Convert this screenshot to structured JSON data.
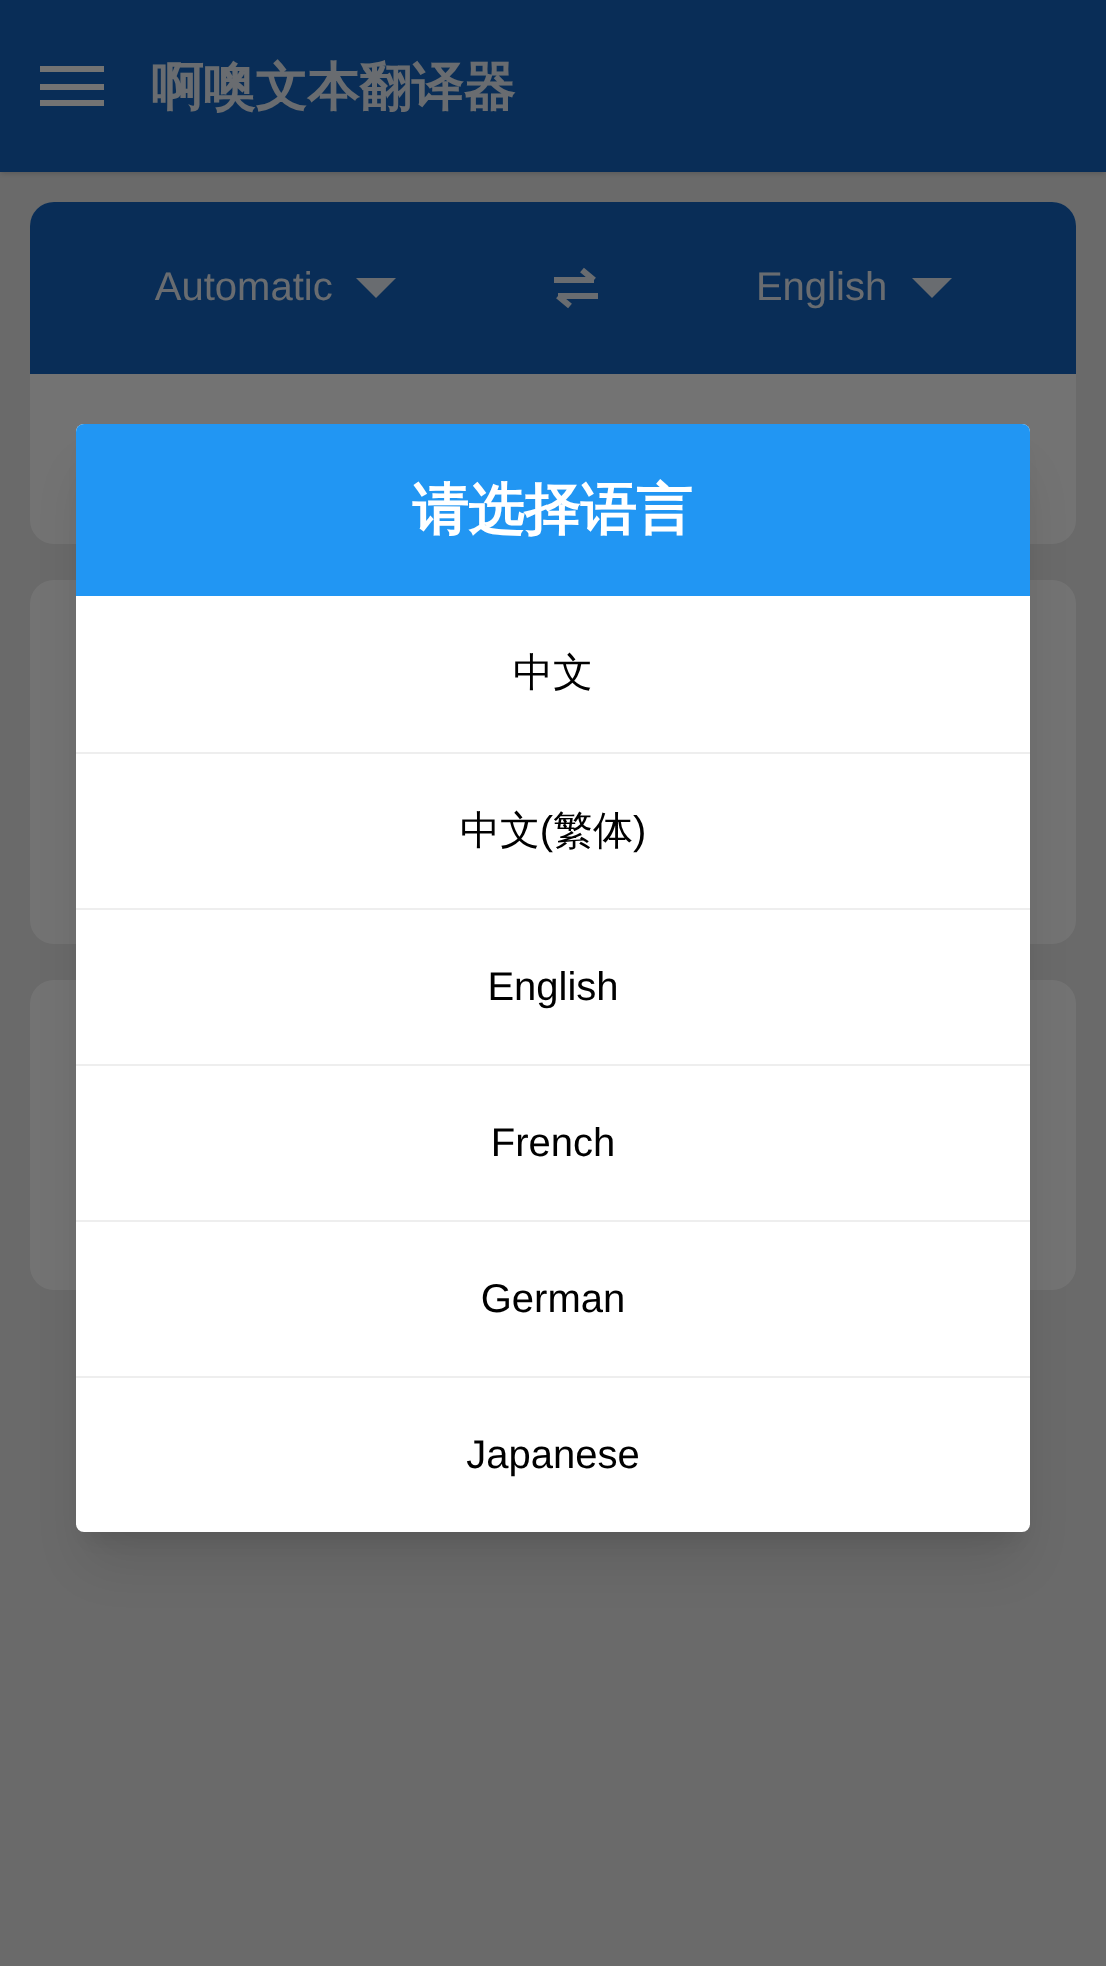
{
  "app_bar": {
    "title": "啊噢文本翻译器"
  },
  "language_bar": {
    "source": "Automatic",
    "target": "English"
  },
  "dialog": {
    "title": "请选择语言",
    "options": [
      {
        "label": "中文"
      },
      {
        "label": "中文(繁体)"
      },
      {
        "label": "English"
      },
      {
        "label": "French"
      },
      {
        "label": "German"
      },
      {
        "label": "Japanese"
      }
    ]
  }
}
